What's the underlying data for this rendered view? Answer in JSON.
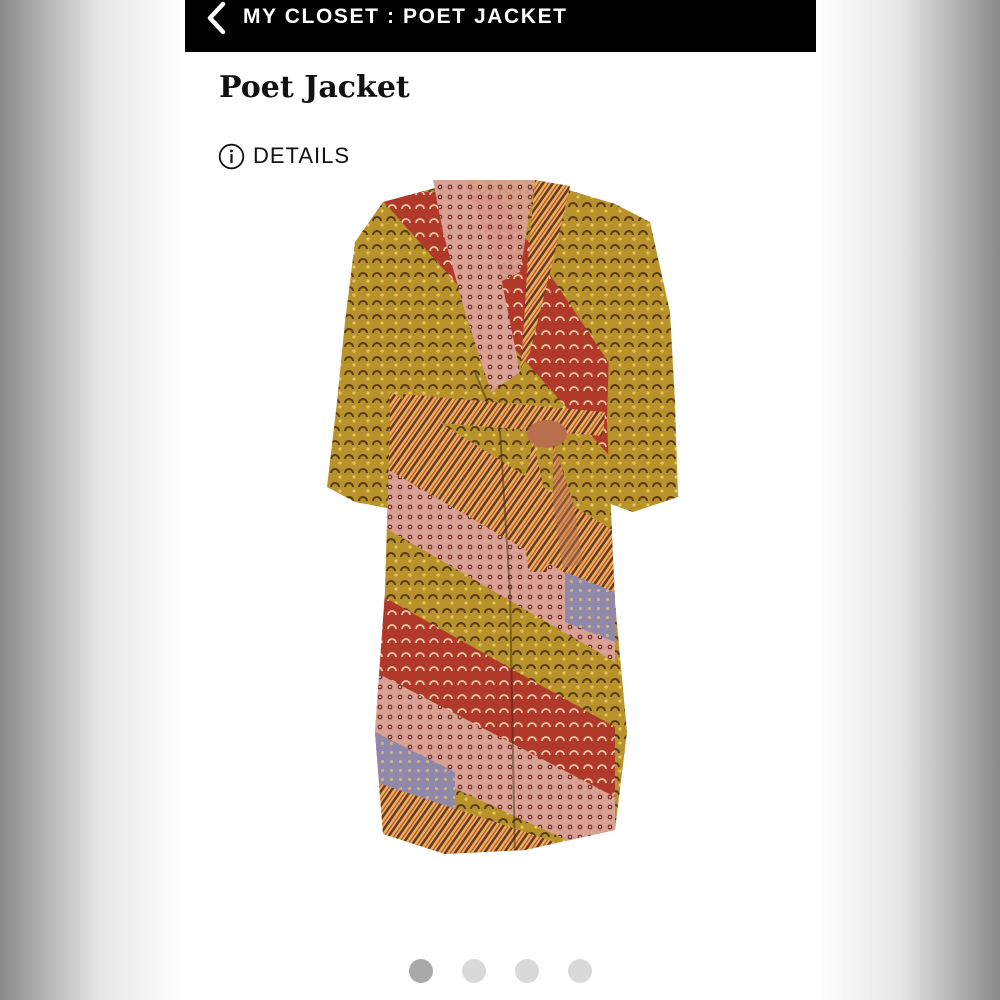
{
  "header": {
    "title": "MY CLOSET : POET JACKET",
    "back_icon": "chevron-left-icon"
  },
  "item": {
    "title": "Poet Jacket",
    "details_label": "DETAILS",
    "details_icon": "info-icon",
    "image_alt": "patchwork print wrap jacket with tie belt"
  },
  "carousel": {
    "count": 4,
    "active_index": 0
  },
  "colors": {
    "header_bg": "#000000",
    "header_text": "#ffffff",
    "dot_active": "#a9a9a9",
    "dot_inactive": "#d9d9d9",
    "mustard": "#b8922a",
    "rust": "#b0392a",
    "blush": "#c98b7d",
    "lavender": "#8f88a8"
  }
}
